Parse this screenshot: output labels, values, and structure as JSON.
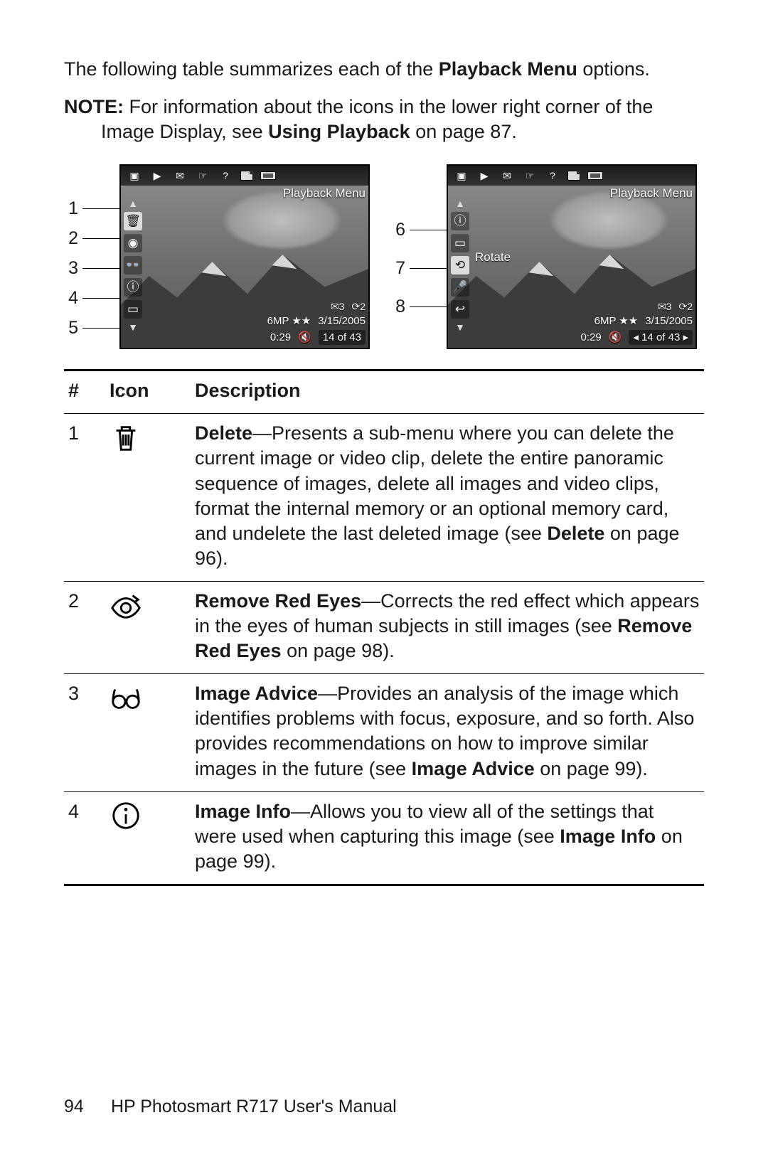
{
  "intro": {
    "pre": "The following table summarizes each of the ",
    "bold": "Playback Menu",
    "post": " options."
  },
  "note": {
    "label": "NOTE:",
    "pre": " For information about the icons in the lower right corner of the Image Display, see ",
    "bold": "Using Playback",
    "post": " on page 87."
  },
  "screens": {
    "title": "Playback Menu",
    "left_callouts": [
      "1",
      "2",
      "3",
      "4",
      "5"
    ],
    "right_callouts": [
      "6",
      "7",
      "8"
    ],
    "right_selected_label": "Rotate",
    "osd": {
      "row1_icons": [
        "✉3",
        "⟳2"
      ],
      "row2": [
        "6MP ★★",
        "3/15/2005"
      ],
      "row3_time": "0:29",
      "row3_counter_left": "14 of 43",
      "row3_counter_right": "◂ 14 of 43 ▸"
    }
  },
  "table": {
    "head": {
      "num": "#",
      "icon": "Icon",
      "desc": "Description"
    },
    "rows": [
      {
        "num": "1",
        "icon": "trash-icon",
        "title": "Delete",
        "body": "—Presents a sub-menu where you can delete the current image or video clip, delete the entire panoramic sequence of images, delete all images and video clips, format the internal memory or an optional memory card, and undelete the last deleted image (see ",
        "ref": "Delete",
        "tail": " on page 96)."
      },
      {
        "num": "2",
        "icon": "redeye-icon",
        "title": "Remove Red Eyes",
        "body": "—Corrects the red effect which appears in the eyes of human subjects in still images (see ",
        "ref": "Remove Red Eyes",
        "tail": " on page 98)."
      },
      {
        "num": "3",
        "icon": "glasses-icon",
        "title": "Image Advice",
        "body": "—Provides an analysis of the image which identifies problems with focus, exposure, and so forth. Also provides recommendations on how to improve similar images in the future (see ",
        "ref": "Image Advice",
        "tail": " on page 99)."
      },
      {
        "num": "4",
        "icon": "info-icon",
        "title": "Image Info",
        "body": "—Allows you to view all of the settings that were used when capturing this image (see ",
        "ref": "Image Info",
        "tail": " on page 99)."
      }
    ]
  },
  "footer": {
    "page": "94",
    "title": "HP Photosmart R717 User's Manual"
  }
}
